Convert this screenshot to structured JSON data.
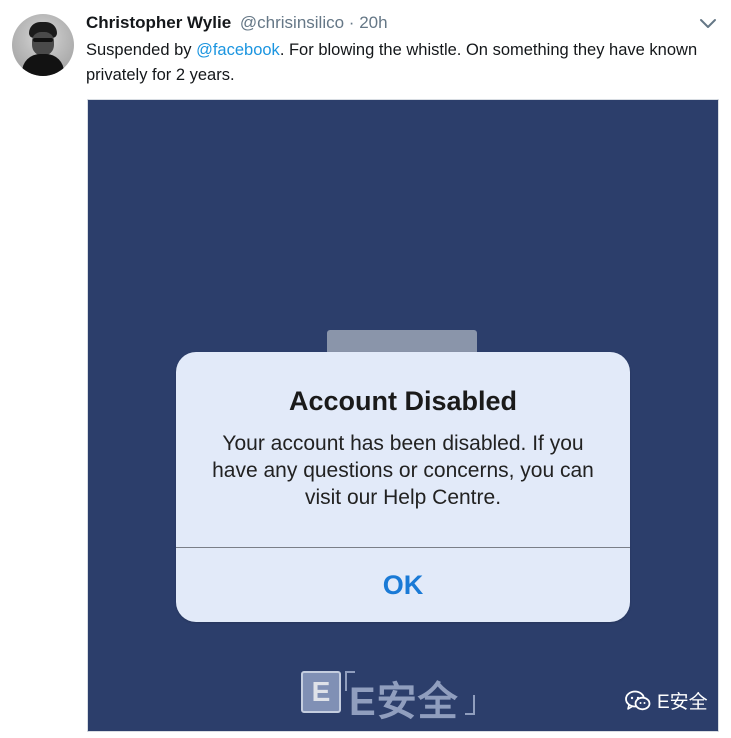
{
  "tweet": {
    "author_name": "Christopher Wylie",
    "author_handle": "@chrisinsilico",
    "separator": "·",
    "timestamp": "20h",
    "text_before_mention": "Suspended by ",
    "mention": "@facebook",
    "text_after_mention": ". For blowing the whistle. On something they have known privately for 2 years."
  },
  "media": {
    "dialog": {
      "title": "Account Disabled",
      "message": "Your account has been disabled. If you have any questions or concerns, you can visit our Help Centre.",
      "ok_label": "OK"
    },
    "watermark": {
      "logo_letter": "E",
      "text": "E安全"
    },
    "wechat_badge": {
      "label": "E安全",
      "icon": "wechat-icon"
    }
  },
  "colors": {
    "media_background": "#2c3e6b",
    "dialog_background": "#e2eaf9",
    "link": "#1b95e0",
    "ok_button": "#1a7ad6"
  }
}
